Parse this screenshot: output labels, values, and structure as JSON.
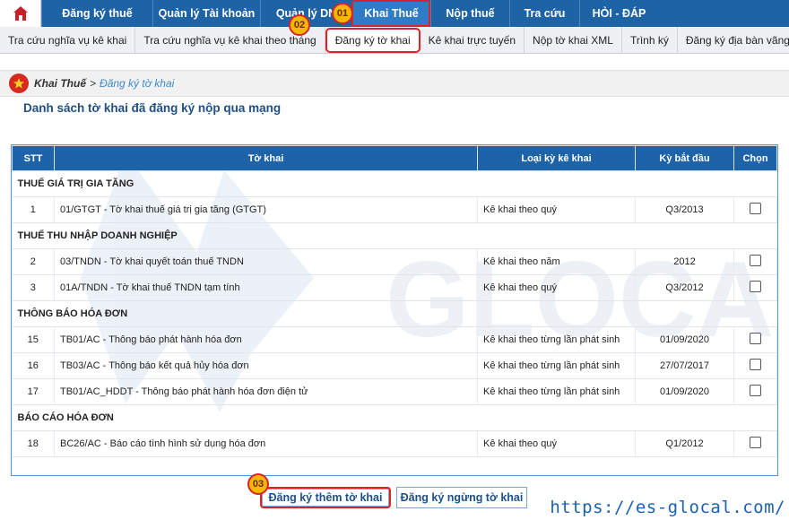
{
  "topnav": {
    "items": [
      "Đăng ký thuế",
      "Quản lý Tài khoản",
      "Quản lý DN",
      "Khai Thuế",
      "Nộp thuế",
      "Tra cứu",
      "HỎI - ĐÁP"
    ],
    "active": "Khai Thuế"
  },
  "subnav": {
    "items": [
      "Tra cứu nghĩa vụ kê khai",
      "Tra cứu nghĩa vụ kê khai theo tháng",
      "Đăng ký tờ khai",
      "Kê khai trực tuyến",
      "Nộp tờ khai XML",
      "Trình ký",
      "Đăng ký địa bàn vãng lai"
    ],
    "active": "Đăng ký tờ khai"
  },
  "breadcrumb": {
    "root": "Khai Thuế",
    "separator": ">",
    "current": "Đăng ký tờ khai"
  },
  "page_title": "Danh sách tờ khai đã đăng ký nộp qua mạng",
  "table": {
    "headers": [
      "STT",
      "Tờ khai",
      "Loại kỳ kê khai",
      "Kỳ bắt đầu",
      "Chọn"
    ],
    "groups": [
      {
        "name": "THUẾ GIÁ TRỊ GIA TĂNG",
        "rows": [
          {
            "stt": "1",
            "form": "01/GTGT - Tờ khai thuế giá trị gia tăng (GTGT)",
            "period_type": "Kê khai theo quý",
            "start": "Q3/2013"
          }
        ]
      },
      {
        "name": "THUẾ THU NHẬP DOANH NGHIỆP",
        "rows": [
          {
            "stt": "2",
            "form": "03/TNDN - Tờ khai quyết toán thuế TNDN",
            "period_type": "Kê khai theo năm",
            "start": "2012"
          },
          {
            "stt": "3",
            "form": "01A/TNDN - Tờ khai thuế TNDN tạm tính",
            "period_type": "Kê khai theo quý",
            "start": "Q3/2012"
          }
        ]
      },
      {
        "name": "THÔNG BÁO HÓA ĐƠN",
        "rows": [
          {
            "stt": "15",
            "form": "TB01/AC - Thông báo phát hành hóa đơn",
            "period_type": "Kê khai theo từng lần phát sinh",
            "start": "01/09/2020"
          },
          {
            "stt": "16",
            "form": "TB03/AC - Thông báo kết quả hủy hóa đơn",
            "period_type": "Kê khai theo từng lần phát sinh",
            "start": "27/07/2017"
          },
          {
            "stt": "17",
            "form": "TB01/AC_HDDT - Thông báo phát hành hóa đơn điện tử",
            "period_type": "Kê khai theo từng lần phát sinh",
            "start": "01/09/2020"
          }
        ]
      },
      {
        "name": "BÁO CÁO HÓA ĐƠN",
        "rows": [
          {
            "stt": "18",
            "form": "BC26/AC - Báo cáo tình hình sử dụng hóa đơn",
            "period_type": "Kê khai theo quý",
            "start": "Q1/2012"
          }
        ]
      }
    ]
  },
  "buttons": {
    "add": "Đăng ký thêm tờ khai",
    "stop": "Đăng ký ngừng tờ khai"
  },
  "badges": [
    "01",
    "02",
    "03"
  ],
  "watermark_text": "GLOCAL",
  "site_url": "https://es-glocal.com/",
  "colors": {
    "nav": "#1d63a6",
    "highlight": "#d9232b",
    "badge": "#f5b700",
    "link": "#3d89c9"
  }
}
